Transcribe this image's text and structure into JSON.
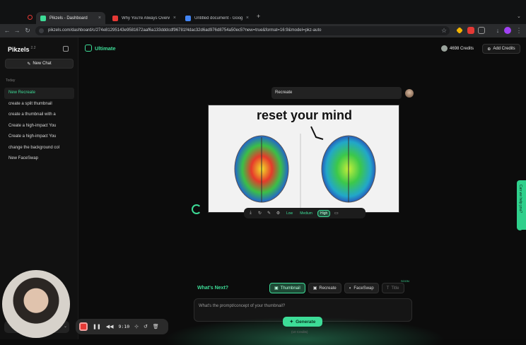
{
  "browser": {
    "tabs": [
      {
        "title": "Pikzels - Dashboard",
        "active": true,
        "favicon_color": "#3ddc97"
      },
      {
        "title": "Why You're Always Overwhel...",
        "active": false,
        "favicon_color": "#e53935"
      },
      {
        "title": "Untitled document - Google D...",
        "active": false,
        "favicon_color": "#4285f4"
      }
    ],
    "new_tab": "+",
    "url": "pikzels.com/dashboard/c/274e81295143e9581672aaf6a133dddcdf96781f4dac32d6ad976d8754a50ec5?new=true&format=16:9&model=pkz-auto"
  },
  "sidebar": {
    "logo": "Pikzels",
    "version": "2.2",
    "new_chat": "New Chat",
    "section": "Today",
    "items": [
      {
        "label": "New Recreate",
        "active": true
      },
      {
        "label": "create a split thumbnail",
        "active": false
      },
      {
        "label": "create a thumbnail with a",
        "active": false
      },
      {
        "label": "Create a high-impact You",
        "active": false
      },
      {
        "label": "Create a high-impact You",
        "active": false
      },
      {
        "label": "change the background col",
        "active": false
      },
      {
        "label": "New FaceSwap",
        "active": false
      }
    ]
  },
  "header": {
    "plan": "Ultimate",
    "credits": "4698 Credits",
    "add_credits": "Add Credits"
  },
  "chat": {
    "prompt": "Recreate",
    "thumbnail_title": "reset your mind",
    "quality": {
      "low": "Low",
      "medium": "Medium",
      "high": "High"
    }
  },
  "help_tab": "Can we help you?",
  "composer": {
    "whats_next": "What's Next?",
    "modes": [
      {
        "label": "Thumbnail",
        "state": "active"
      },
      {
        "label": "Recreate",
        "state": "normal"
      },
      {
        "label": "FaceSwap",
        "state": "normal"
      },
      {
        "label": "Title",
        "state": "disabled"
      }
    ],
    "soon": "SOON",
    "placeholder": "What's the prompt/concept of your thumbnail?",
    "generate": "Generate",
    "cost": "(10 Credits)"
  },
  "recorder": {
    "time": "9:10"
  },
  "colors": {
    "accent": "#3ddc97",
    "background": "#0c0c0c",
    "stop": "#e53935"
  }
}
